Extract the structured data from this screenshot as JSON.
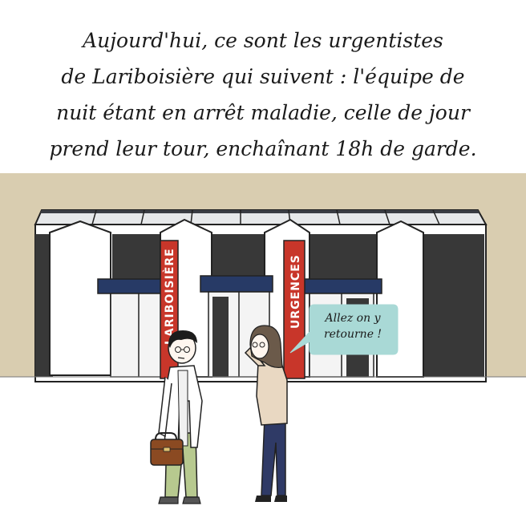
{
  "caption": {
    "lines": [
      "Aujourd'hui, ce sont les urgentistes",
      "de Lariboisière qui suivent : l'équipe de",
      "nuit étant en arrêt maladie, celle de jour",
      "prend leur tour, enchaînant 18h de garde."
    ]
  },
  "signs": {
    "hospital": "LARIBOISIÈRE",
    "emergency": "URGENCES"
  },
  "speech": {
    "lines": [
      "Allez on y",
      "retourne !"
    ]
  },
  "colors": {
    "background_band": "#d9cdb0",
    "sign_red": "#c8362a",
    "awning_blue": "#273a66",
    "facade_dark": "#383838",
    "speech_bubble": "#a9d9d6",
    "bag_brown": "#8b4a22",
    "trousers_green": "#b7c98f",
    "coat_beige": "#e9d8c2",
    "jeans_navy": "#2f3a66"
  }
}
